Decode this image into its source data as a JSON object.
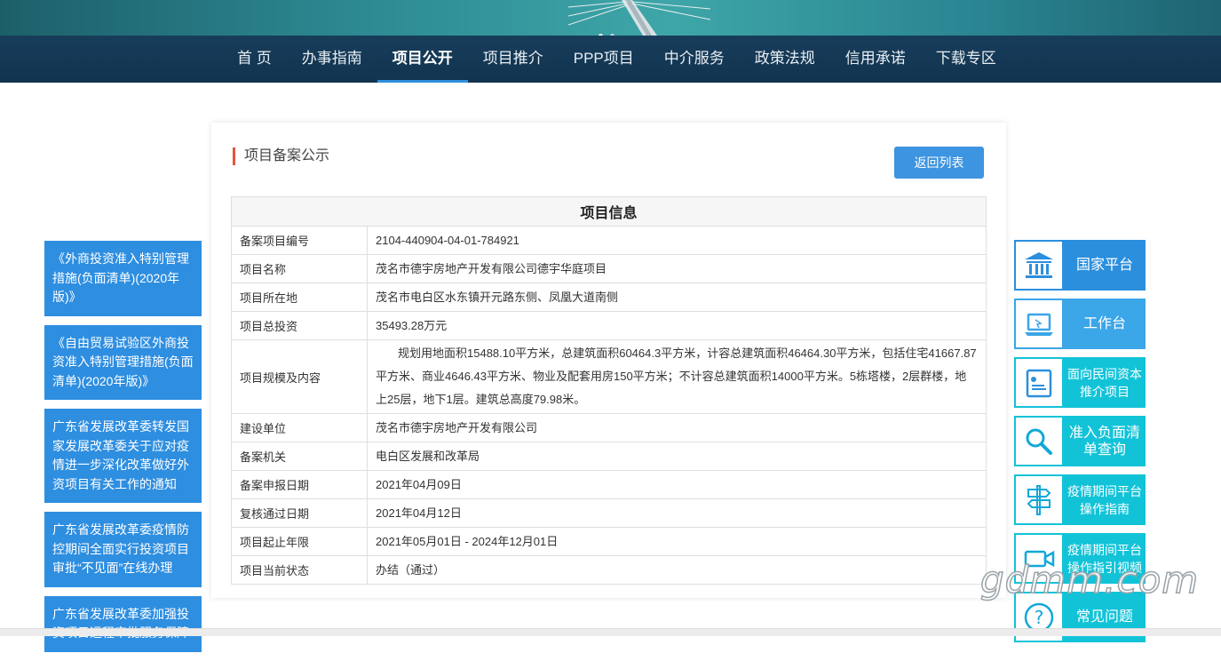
{
  "nav": {
    "items": [
      {
        "label": "首 页"
      },
      {
        "label": "办事指南"
      },
      {
        "label": "项目公开",
        "active": true
      },
      {
        "label": "项目推介"
      },
      {
        "label": "PPP项目"
      },
      {
        "label": "中介服务"
      },
      {
        "label": "政策法规"
      },
      {
        "label": "信用承诺"
      },
      {
        "label": "下载专区"
      }
    ]
  },
  "left_links": [
    {
      "text": "《外商投资准入特别管理措施(负面清单)(2020年版)》"
    },
    {
      "text": "《自由贸易试验区外商投资准入特别管理措施(负面清单)(2020年版)》"
    },
    {
      "text": "广东省发展改革委转发国家发展改革委关于应对疫情进一步深化改革做好外资项目有关工作的通知"
    },
    {
      "text": "广东省发展改革委疫情防控期间全面实行投资项目审批“不见面”在线办理"
    },
    {
      "text": "广东省发展改革委加强投资项目远程审批服务保障"
    }
  ],
  "panel": {
    "title": "项目备案公示",
    "back_button": "返回列表",
    "table_heading": "项目信息",
    "rows": [
      {
        "key": "备案项目编号",
        "value": "2104-440904-04-01-784921"
      },
      {
        "key": "项目名称",
        "value": "茂名市德宇房地产开发有限公司德宇华庭项目"
      },
      {
        "key": "项目所在地",
        "value": "茂名市电白区水东镇开元路东侧、凤凰大道南侧"
      },
      {
        "key": "项目总投资",
        "value": "35493.28万元"
      },
      {
        "key": "项目规模及内容",
        "value": "规划用地面积15488.10平方米，总建筑面积60464.3平方米，计容总建筑面积46464.30平方米，包括住宅41667.87平方米、商业4646.43平方米、物业及配套用房150平方米；不计容总建筑面积14000平方米。5栋塔楼，2层群楼，地上25层，地下1层。建筑总高度79.98米。"
      },
      {
        "key": "建设单位",
        "value": "茂名市德宇房地产开发有限公司"
      },
      {
        "key": "备案机关",
        "value": "电白区发展和改革局"
      },
      {
        "key": "备案申报日期",
        "value": "2021年04月09日"
      },
      {
        "key": "复核通过日期",
        "value": "2021年04月12日"
      },
      {
        "key": "项目起止年限",
        "value": "2021年05月01日 - 2024年12月01日"
      },
      {
        "key": "项目当前状态",
        "value": "办结（通过）"
      }
    ]
  },
  "right_links": [
    {
      "label": "国家平台",
      "icon": "government-building-icon"
    },
    {
      "label": "工作台",
      "icon": "laptop-icon"
    },
    {
      "label": "面向民间资本推介项目",
      "icon": "document-list-icon"
    },
    {
      "label": "准入负面清单查询",
      "icon": "magnifier-icon"
    },
    {
      "label": "疫情期间平台操作指南",
      "icon": "signpost-icon"
    },
    {
      "label": "疫情期间平台操作指引视频",
      "icon": "video-camera-icon"
    },
    {
      "label": "常见问题",
      "icon": "question-icon"
    }
  ],
  "watermark": "gdmm.com",
  "colors": {
    "nav_bg": "#173d5b",
    "nav_active_underline": "#2f8fde",
    "blue": "#2b8fde",
    "light_blue": "#3ba6e8",
    "cyan": "#12c3d8",
    "title_marker": "#e0563b"
  }
}
